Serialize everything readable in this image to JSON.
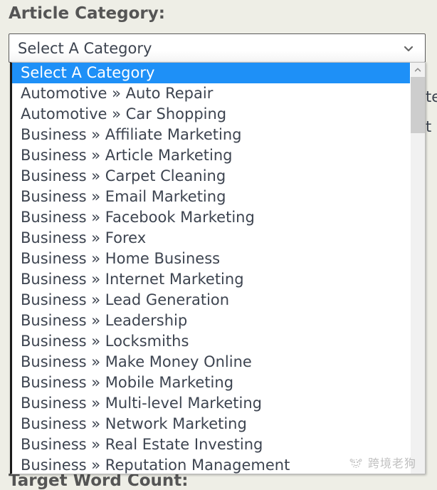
{
  "page": {
    "background_color": "#eeeee6",
    "label_color": "#555555"
  },
  "form": {
    "category_label": "Article Category:",
    "word_count_label": "Target Word Count:"
  },
  "select": {
    "name": "article-category",
    "value": "Select A Category",
    "placeholder": "Select A Category",
    "chevron_icon": "chevron-down-icon",
    "expanded": true,
    "highlight_color": "#1e90f7",
    "text_color": "#3d4450"
  },
  "dropdown": {
    "selected_index": 0,
    "visible_count": 20,
    "options": [
      "Select A Category",
      "Automotive » Auto Repair",
      "Automotive » Car Shopping",
      "Business » Affiliate Marketing",
      "Business » Article Marketing",
      "Business » Carpet Cleaning",
      "Business » Email Marketing",
      "Business » Facebook Marketing",
      "Business » Forex",
      "Business » Home Business",
      "Business » Internet Marketing",
      "Business » Lead Generation",
      "Business » Leadership",
      "Business » Locksmiths",
      "Business » Make Money Online",
      "Business » Mobile Marketing",
      "Business » Multi-level Marketing",
      "Business » Network Marketing",
      "Business » Real Estate Investing",
      "Business » Reputation Management"
    ],
    "scrollbar": {
      "up_arrow_icon": "chevron-up-icon",
      "thumb_color": "#cdcdcd",
      "track_color": "#f1f1f1"
    }
  },
  "background_fragments": {
    "fragment_one": "te",
    "fragment_two": "t"
  },
  "watermark": {
    "text": "跨境老狗",
    "icon": "paw-print-icon"
  }
}
